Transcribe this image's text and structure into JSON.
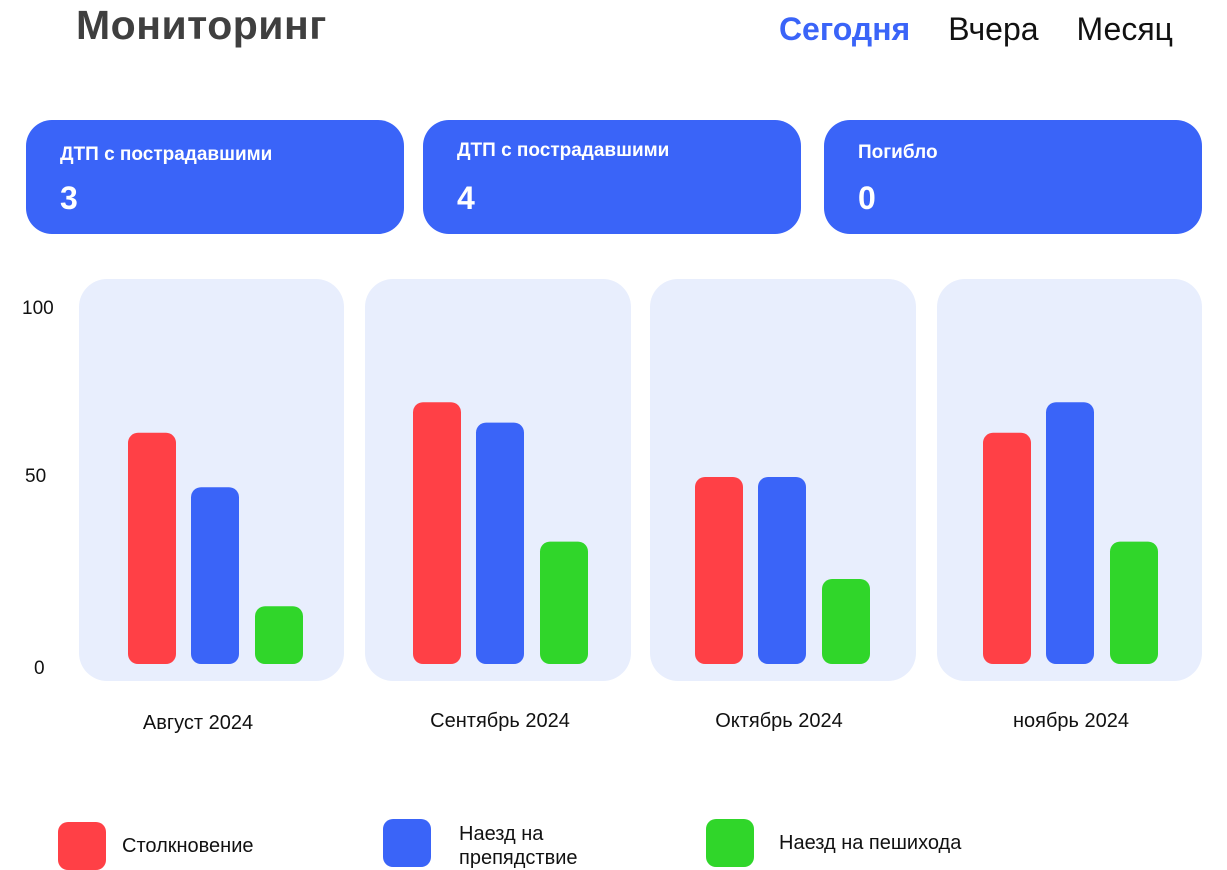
{
  "header": {
    "title": "Мониторинг",
    "tabs": [
      {
        "label": "Сегодня",
        "active": true
      },
      {
        "label": "Вчера",
        "active": false
      },
      {
        "label": "Месяц",
        "active": false
      }
    ]
  },
  "cards": [
    {
      "label": "ДТП с пострадавшими",
      "value": "3"
    },
    {
      "label": "ДТП с пострадавшими",
      "value": "4"
    },
    {
      "label": "Погибло",
      "value": "0"
    }
  ],
  "colors": {
    "accent": "#3a64f8",
    "panel": "#e8eefd",
    "collision": "#ff4046",
    "obstacle": "#3a64f8",
    "pedestrian": "#30d62a"
  },
  "chart_data": {
    "type": "bar",
    "categories": [
      "Август 2024",
      "Сентябрь 2024",
      "Октябрь 2024",
      "ноябрь 2024"
    ],
    "series": [
      {
        "name": "Столкновение",
        "values": [
          68,
          77,
          55,
          68
        ]
      },
      {
        "name": "Наезд на препядствие",
        "values": [
          52,
          71,
          55,
          77
        ]
      },
      {
        "name": "Наезд на пешихода",
        "values": [
          17,
          36,
          25,
          36
        ]
      }
    ],
    "yticks": [
      "100",
      "50",
      "0"
    ],
    "ylim": [
      0,
      100
    ],
    "legend": "bottom"
  }
}
